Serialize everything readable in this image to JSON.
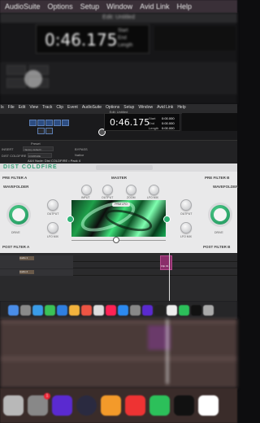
{
  "top_menu": [
    "AudioSuite",
    "Options",
    "Setup",
    "Window",
    "Avid Link",
    "Help"
  ],
  "top_window": {
    "title": "Edit: Untitled",
    "counter": "0:46.175",
    "labels": [
      "Start",
      "End",
      "Length"
    ]
  },
  "daw_menu": [
    "ls",
    "File",
    "Edit",
    "View",
    "Track",
    "Clip",
    "Event",
    "AudioSuite",
    "Options",
    "Setup",
    "Window",
    "Avid Link",
    "Help"
  ],
  "daw_window": {
    "title": "Edit: Untitled",
    "counter": "0:46.175",
    "counter_labels": [
      "Start",
      "End",
      "Length"
    ],
    "counter_values": [
      "0:00.000",
      "0:00.000",
      "0:00.000"
    ]
  },
  "plugin_header": {
    "preset_label": "Preset",
    "preset_value": "<factory default>",
    "compare": "COMPARE",
    "bypass": "BYPASS",
    "native": "Native",
    "insert": "INSERT",
    "track": "DIST COLDFIRE",
    "title_bar": "AAX Node: Dist COLDFIRE • Pack 4"
  },
  "plugin": {
    "name": "DIST COLDFIRE",
    "section_left": "PRE FILTER A",
    "section_right": "PRE FILTER B",
    "master": "MASTER",
    "waveform_label": "WAVEFOLDER",
    "knob_drive": "DRIVE",
    "knob_output": "OUTPUT",
    "knob_lfo_mix": "LFO MIX",
    "master_knobs": [
      "INPUT",
      "OUTPUT",
      "ZOOM",
      "LFO MIX"
    ],
    "mode": "PRM LFO",
    "post_left": "POST FILTER A",
    "post_right": "POST FILTER B",
    "colors": {
      "accent": "#2fb576",
      "bg": "#e9e9ea"
    }
  },
  "tracks": {
    "names": [
      "Audio 1",
      "Audio 2"
    ],
    "clip_name": "Clip 01"
  },
  "dock_icons": [
    "finder",
    "launchpad",
    "safari",
    "messages",
    "mail",
    "maps",
    "photos",
    "facetime",
    "calendar",
    "contacts",
    "reminders",
    "notes",
    "tv",
    "music",
    "podcasts",
    "appstore",
    "settings",
    "protools",
    "capcut",
    "office",
    "whatsapp",
    "capcut2",
    "trash"
  ],
  "dock_badge": "1"
}
